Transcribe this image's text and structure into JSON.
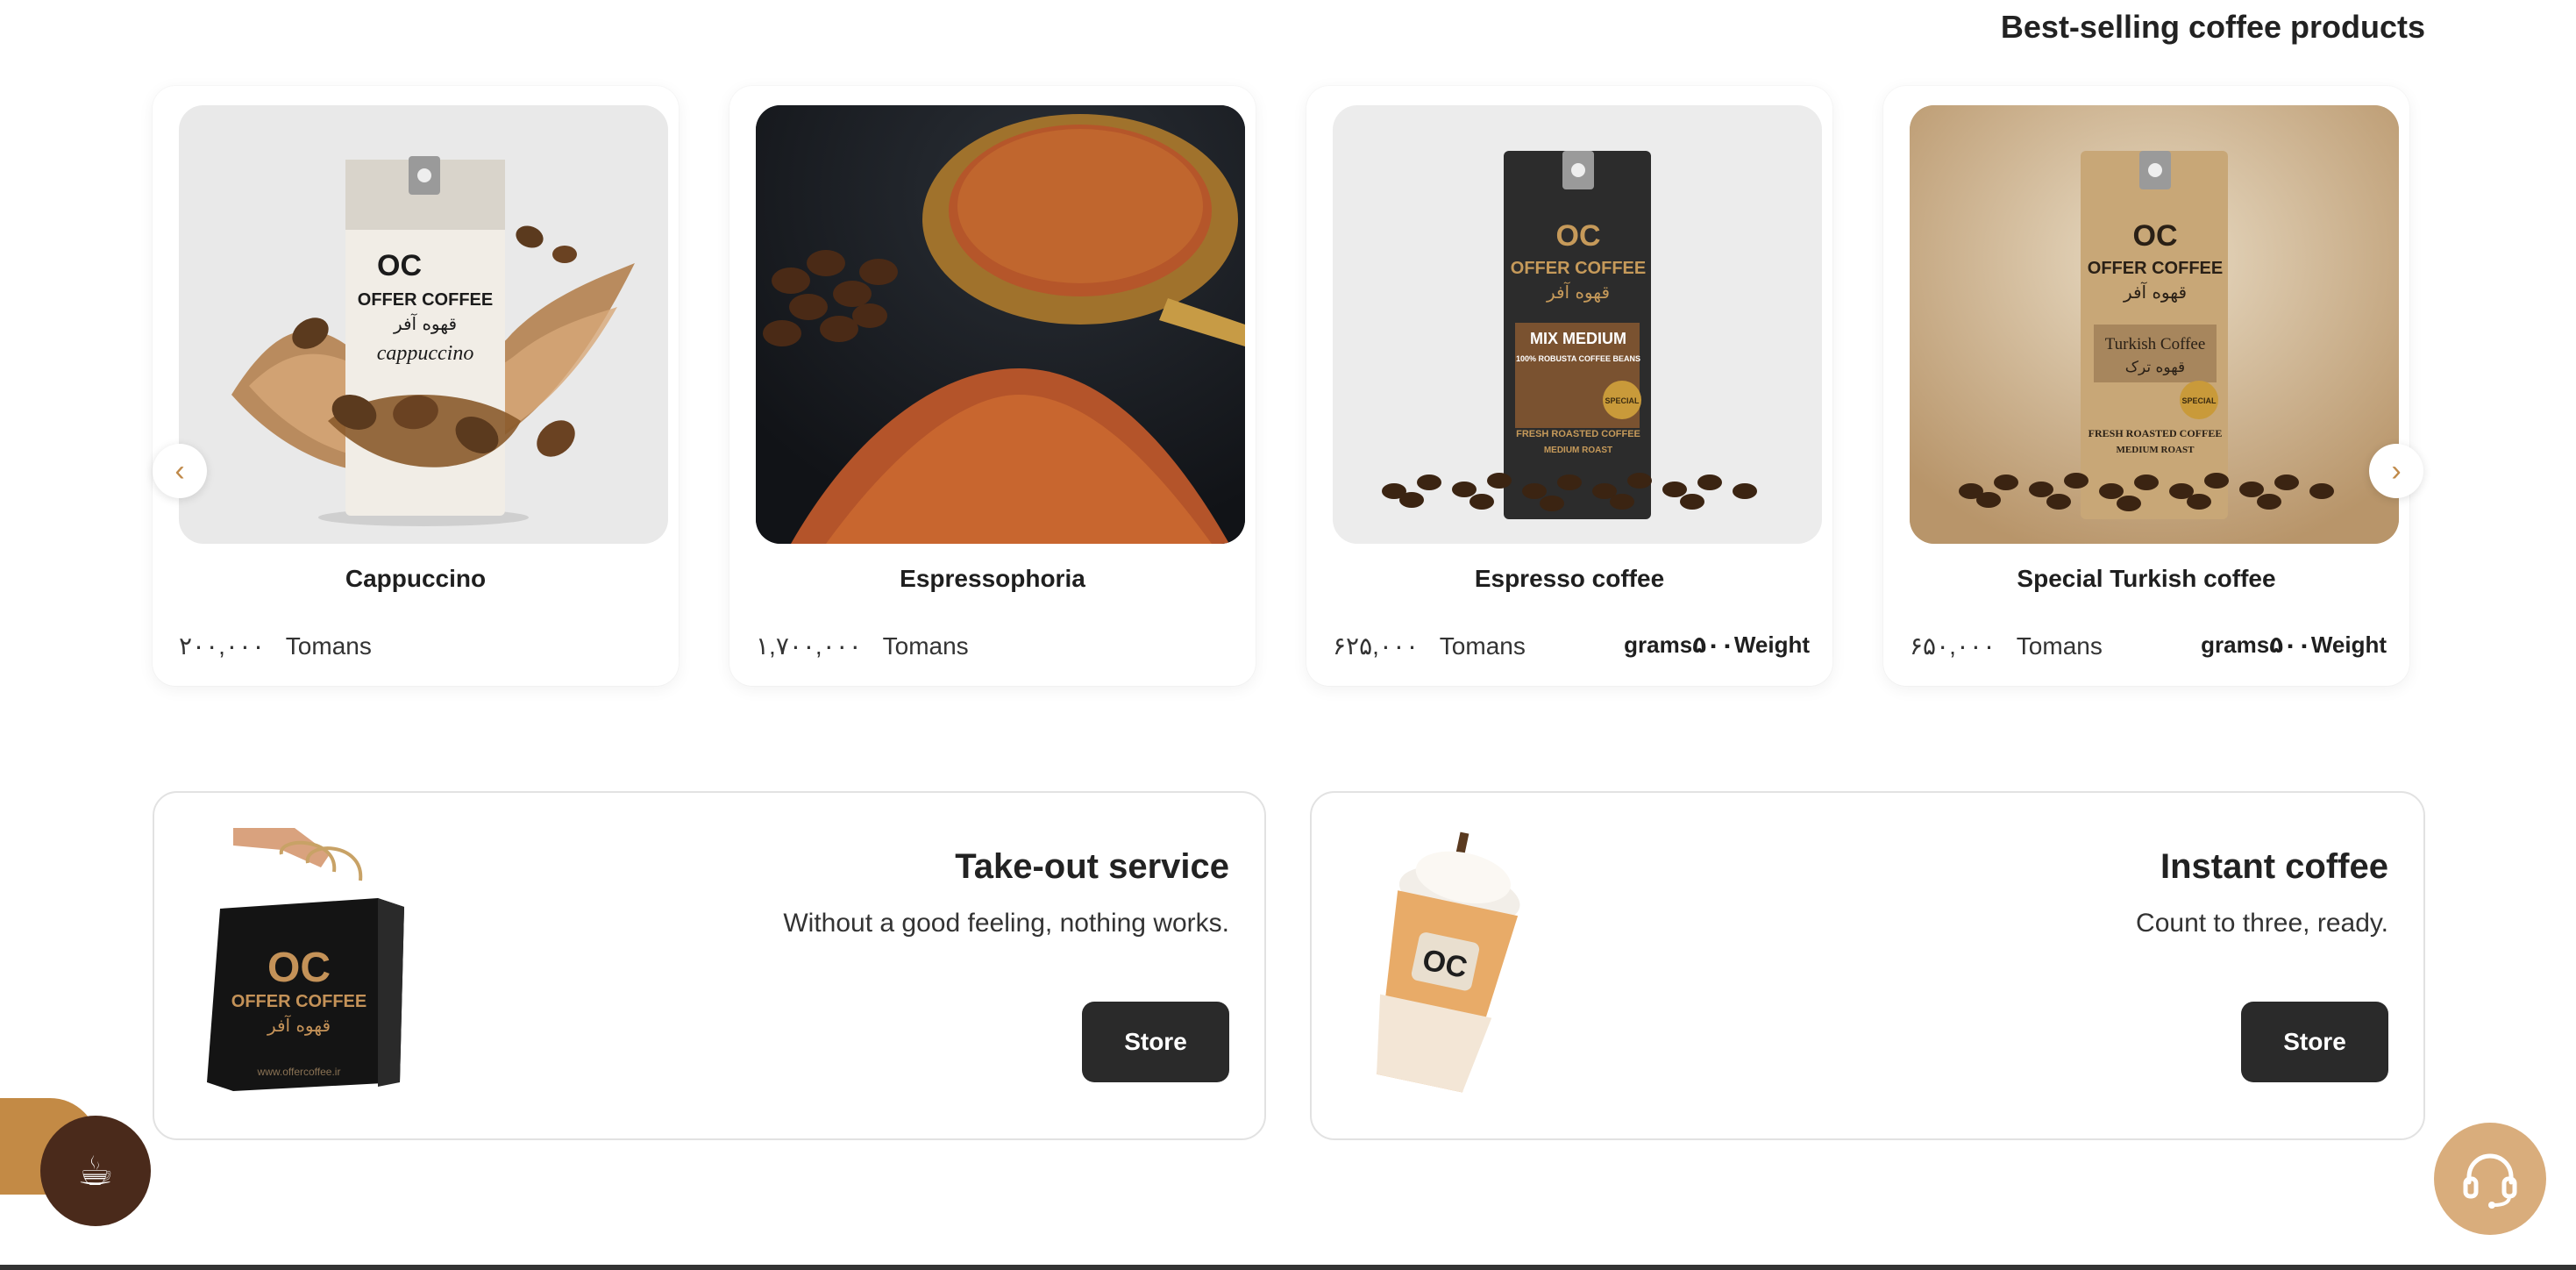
{
  "section": {
    "title": "Best-selling coffee products"
  },
  "products": [
    {
      "name": "Cappuccino",
      "price": "۲۰۰,۰۰۰",
      "currency": "Tomans",
      "weight": ""
    },
    {
      "name": "Espressophoria",
      "price": "۱,۷۰۰,۰۰۰",
      "currency": "Tomans",
      "weight": ""
    },
    {
      "name": "Espresso coffee",
      "price": "۶۲۵,۰۰۰",
      "currency": "Tomans",
      "weight": "grams۵۰۰Weight"
    },
    {
      "name": "Special Turkish coffee",
      "price": "۶۵۰,۰۰۰",
      "currency": "Tomans",
      "weight": "grams۵۰۰Weight"
    }
  ],
  "carousel": {
    "prev_icon": "chevron-left-icon",
    "next_icon": "chevron-right-icon",
    "prev_glyph": "‹",
    "next_glyph": "›"
  },
  "package_labels": {
    "brand_mark": "OC",
    "brand": "OFFER COFFEE",
    "brand_fa": "قهوه آفر",
    "cappuccino": "cappuccino",
    "mix_title": "MIX MEDIUM",
    "mix_sub": "100% ROBUSTA COFFEE BEANS",
    "roast": "FRESH ROASTED COFFEE",
    "roast_level": "MEDIUM ROAST",
    "turkish": "Turkish Coffee",
    "turkish_fa": "قهوه ترک",
    "special": "SPECIAL",
    "url": "www.offercoffee.ir"
  },
  "banners": [
    {
      "title": "Take-out service",
      "subtitle": "Without a good feeling, nothing works.",
      "button": "Store"
    },
    {
      "title": "Instant coffee",
      "subtitle": "Count to three, ready.",
      "button": "Store"
    }
  ],
  "floating": {
    "coffee_icon": "coffee-cup-icon",
    "coffee_glyph": "☕",
    "support_icon": "headset-icon"
  },
  "colors": {
    "accent": "#c38a45",
    "dark_button": "#2a2a2a",
    "support_fab": "#d9ad7c",
    "coffee_fab": "#4a2a1b"
  }
}
